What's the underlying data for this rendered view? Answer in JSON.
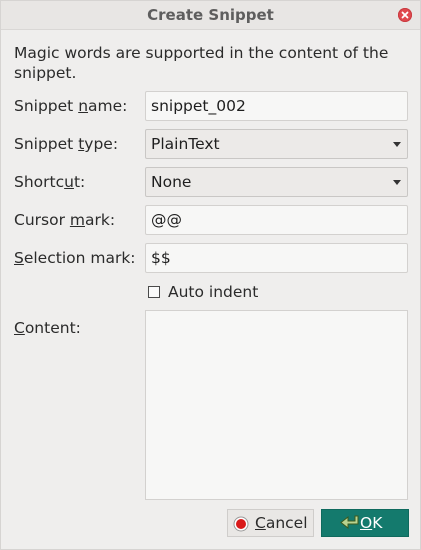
{
  "window": {
    "title": "Create Snippet"
  },
  "intro": {
    "text": "Magic words are supported in the content of the snippet."
  },
  "form": {
    "snippet_name": {
      "label_pre": "Snippet ",
      "label_u": "n",
      "label_post": "ame:",
      "value": "snippet_002"
    },
    "snippet_type": {
      "label_pre": "Snippet ",
      "label_u": "t",
      "label_post": "ype:",
      "value": "PlainText"
    },
    "shortcut": {
      "label_pre": "Shortc",
      "label_u": "u",
      "label_post": "t:",
      "value": "None"
    },
    "cursor_mark": {
      "label_pre": "Cursor ",
      "label_u": "m",
      "label_post": "ark:",
      "value": "@@"
    },
    "selection_mark": {
      "label_pre": "",
      "label_u": "S",
      "label_post": "election mark:",
      "value": "$$"
    },
    "auto_indent": {
      "label": "Auto indent",
      "checked": false
    },
    "content": {
      "label_pre": "",
      "label_u": "C",
      "label_post": "ontent:",
      "value": ""
    }
  },
  "buttons": {
    "cancel": {
      "label_u": "C",
      "label_post": "ancel"
    },
    "ok": {
      "label_u": "O",
      "label_post": "K"
    }
  },
  "colors": {
    "ok_background": "#147a6d",
    "close_button": "#e0484e",
    "dialog_background": "#efeeed"
  },
  "icons": {
    "close": "close-icon",
    "cancel": "stop-icon",
    "ok": "return-arrow-icon"
  }
}
